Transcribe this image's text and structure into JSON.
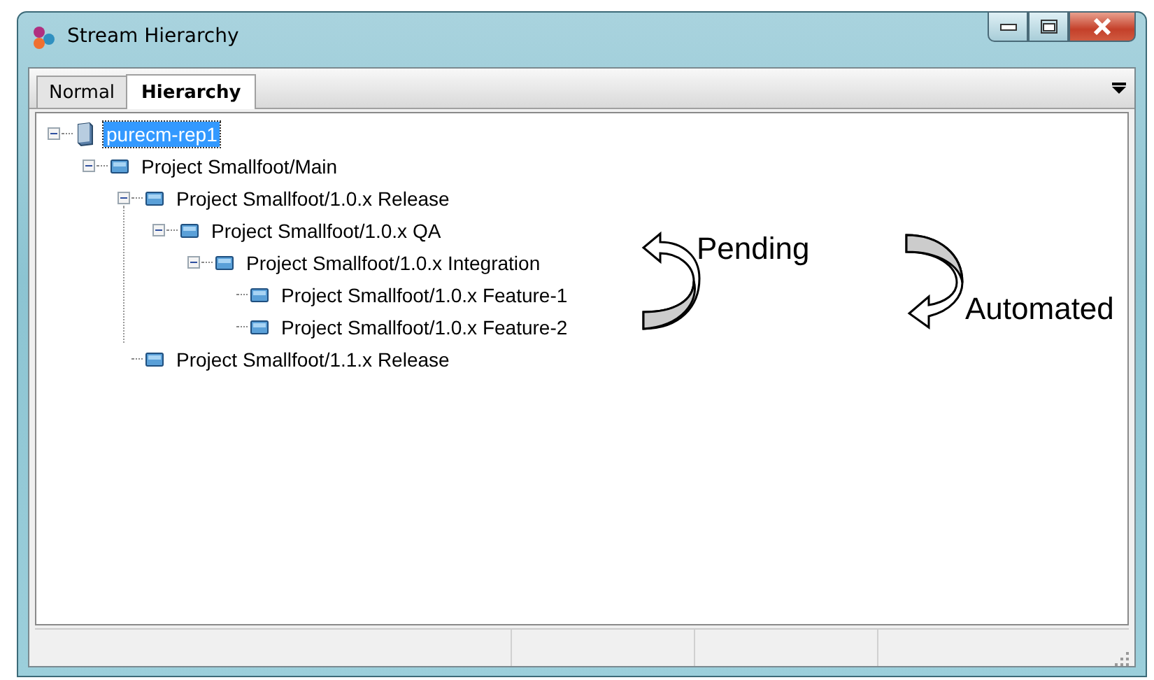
{
  "window": {
    "title": "Stream Hierarchy"
  },
  "tabs": [
    {
      "label": "Normal",
      "selected": false
    },
    {
      "label": "Hierarchy",
      "selected": true
    }
  ],
  "tree": [
    {
      "label": "purecm-rep1",
      "kind": "repository",
      "selected": true,
      "expanded": true,
      "children": [
        {
          "label": "Project Smallfoot/Main",
          "kind": "stream",
          "selected": false,
          "expanded": true,
          "children": [
            {
              "label": "Project Smallfoot/1.0.x Release",
              "kind": "stream",
              "selected": false,
              "expanded": true,
              "children": [
                {
                  "label": "Project Smallfoot/1.0.x QA",
                  "kind": "stream",
                  "selected": false,
                  "expanded": true,
                  "children": [
                    {
                      "label": "Project Smallfoot/1.0.x Integration",
                      "kind": "stream",
                      "selected": false,
                      "expanded": true,
                      "children": [
                        {
                          "label": "Project Smallfoot/1.0.x Feature-1",
                          "kind": "stream",
                          "selected": false
                        },
                        {
                          "label": "Project Smallfoot/1.0.x Feature-2",
                          "kind": "stream",
                          "selected": false
                        }
                      ]
                    }
                  ]
                }
              ]
            },
            {
              "label": "Project Smallfoot/1.1.x Release",
              "kind": "stream",
              "selected": false
            }
          ]
        }
      ]
    }
  ],
  "annotations": [
    {
      "label": "Pending",
      "kind": "up"
    },
    {
      "label": "Automated",
      "kind": "down"
    }
  ]
}
